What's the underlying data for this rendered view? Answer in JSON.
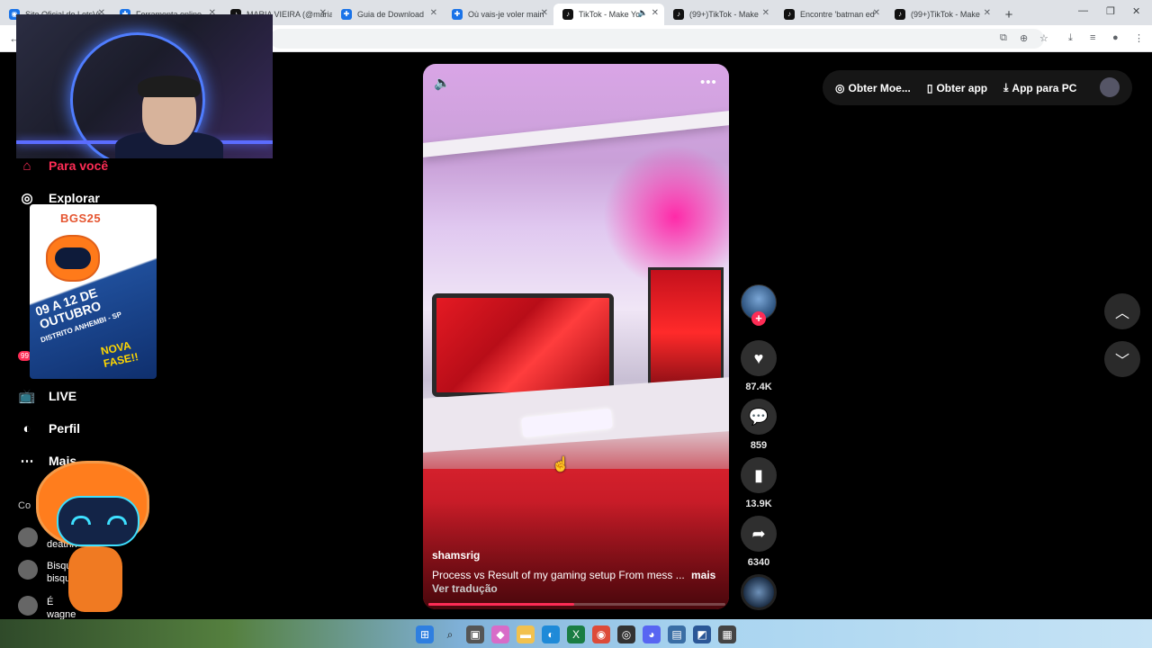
{
  "browser": {
    "tabs": [
      {
        "title": "Site Oficial do LetsVi",
        "active": false
      },
      {
        "title": "Ferramenta online",
        "active": false
      },
      {
        "title": "MARIA VIEIRA (@maria",
        "active": false
      },
      {
        "title": "Guia de Download",
        "active": false
      },
      {
        "title": "Où vais-je voler main",
        "active": false
      },
      {
        "title": "TikTok - Make Yo",
        "active": true
      },
      {
        "title": "(99+)TikTok - Make",
        "active": false
      },
      {
        "title": "Encontre 'batman ed",
        "active": false
      },
      {
        "title": "(99+)TikTok - Make",
        "active": false
      }
    ],
    "new_tab_label": "+"
  },
  "sidebar": {
    "items": [
      {
        "label": "Para você",
        "icon": "home-icon",
        "active": true
      },
      {
        "label": "Explorar",
        "icon": "compass-icon",
        "active": false
      },
      {
        "label": "LIVE",
        "icon": "live-tv-icon",
        "active": false
      },
      {
        "label": "Perfil",
        "icon": "profile-avatar-icon",
        "active": false
      },
      {
        "label": "Mais",
        "icon": "more-dots-icon",
        "active": false
      }
    ],
    "badge": "99",
    "following_title": "Co",
    "following": [
      {
        "name": "deathn"
      },
      {
        "name": "Bisqui",
        "handle": "bisqui"
      },
      {
        "name": "É",
        "handle": "wagne"
      }
    ]
  },
  "promo": {
    "logo": "BGS25",
    "date": "09 A 12 DE OUTUBRO",
    "place": "DISTRITO ANHEMBI - SP",
    "tagline": "NOVA FASE!!"
  },
  "video": {
    "author": "shamsrig",
    "description": "Process vs Result of my gaming setup From mess ...",
    "more_label": "mais",
    "translate_label": "Ver tradução",
    "progress": 0.49
  },
  "actions": {
    "likes": "87.4K",
    "comments": "859",
    "saves": "13.9K",
    "shares": "6340"
  },
  "topbar": {
    "coins_label": "Obter Moe...",
    "app_label": "Obter app",
    "pc_label": "App para PC"
  },
  "colors": {
    "accent": "#fe2c55",
    "background": "#000000",
    "pill": "#161616"
  }
}
